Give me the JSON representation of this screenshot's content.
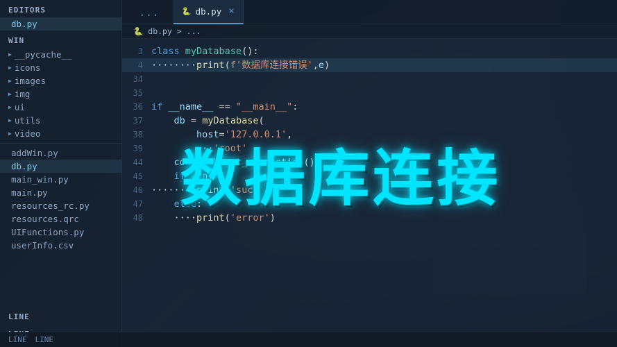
{
  "sidebar": {
    "editors_label": "EDITORS",
    "win_label": "WIN",
    "active_file": "db.py",
    "folders": [
      {
        "name": "__pycache__",
        "type": "folder"
      },
      {
        "name": "icons",
        "type": "folder"
      },
      {
        "name": "images",
        "type": "folder"
      },
      {
        "name": "img",
        "type": "folder"
      },
      {
        "name": "ui",
        "type": "folder"
      },
      {
        "name": "utils",
        "type": "folder"
      },
      {
        "name": "video",
        "type": "folder"
      }
    ],
    "files": [
      {
        "name": "addWin.py",
        "active": false
      },
      {
        "name": "db.py",
        "active": true
      },
      {
        "name": "main_win.py",
        "active": false
      },
      {
        "name": "main.py",
        "active": false
      },
      {
        "name": "resources_rc.py",
        "active": false
      },
      {
        "name": "resources.qrc",
        "active": false
      },
      {
        "name": "UIFunctions.py",
        "active": false
      },
      {
        "name": "userInfo.csv",
        "active": false
      }
    ],
    "bottom_items": [
      "LINE",
      "LINE"
    ]
  },
  "tabs": {
    "inactive": {
      "label": "...",
      "icon": "⋯"
    },
    "active": {
      "label": "db.py",
      "icon": "🐍",
      "close": "×"
    }
  },
  "breadcrumb": {
    "path": "db.py > ..."
  },
  "code": {
    "lines": [
      {
        "num": 3,
        "content": "class myDatabase():"
      },
      {
        "num": 4,
        "content": "        ········print(f'数据库连接错误',e)",
        "highlight": true
      },
      {
        "num": 34,
        "content": ""
      },
      {
        "num": 35,
        "content": ""
      },
      {
        "num": 36,
        "content": "if __name__ == \"__main__\":"
      },
      {
        "num": 37,
        "content": "    db = myDatabase("
      },
      {
        "num": 38,
        "content": "        host='127.0.0.1',"
      },
      {
        "num": 39,
        "content": "        ···'root'"
      },
      {
        "num": 44,
        "content": "    con = db.get_connection();"
      },
      {
        "num": 45,
        "content": "    if con:"
      },
      {
        "num": 46,
        "content": "        ········print('succ')"
      },
      {
        "num": 47,
        "content": "    else:"
      },
      {
        "num": 48,
        "content": "        ····print('error')"
      }
    ]
  },
  "overlay": {
    "title": "数据库连接"
  },
  "statusbar": {
    "items": [
      "LINE",
      "LINE"
    ]
  }
}
